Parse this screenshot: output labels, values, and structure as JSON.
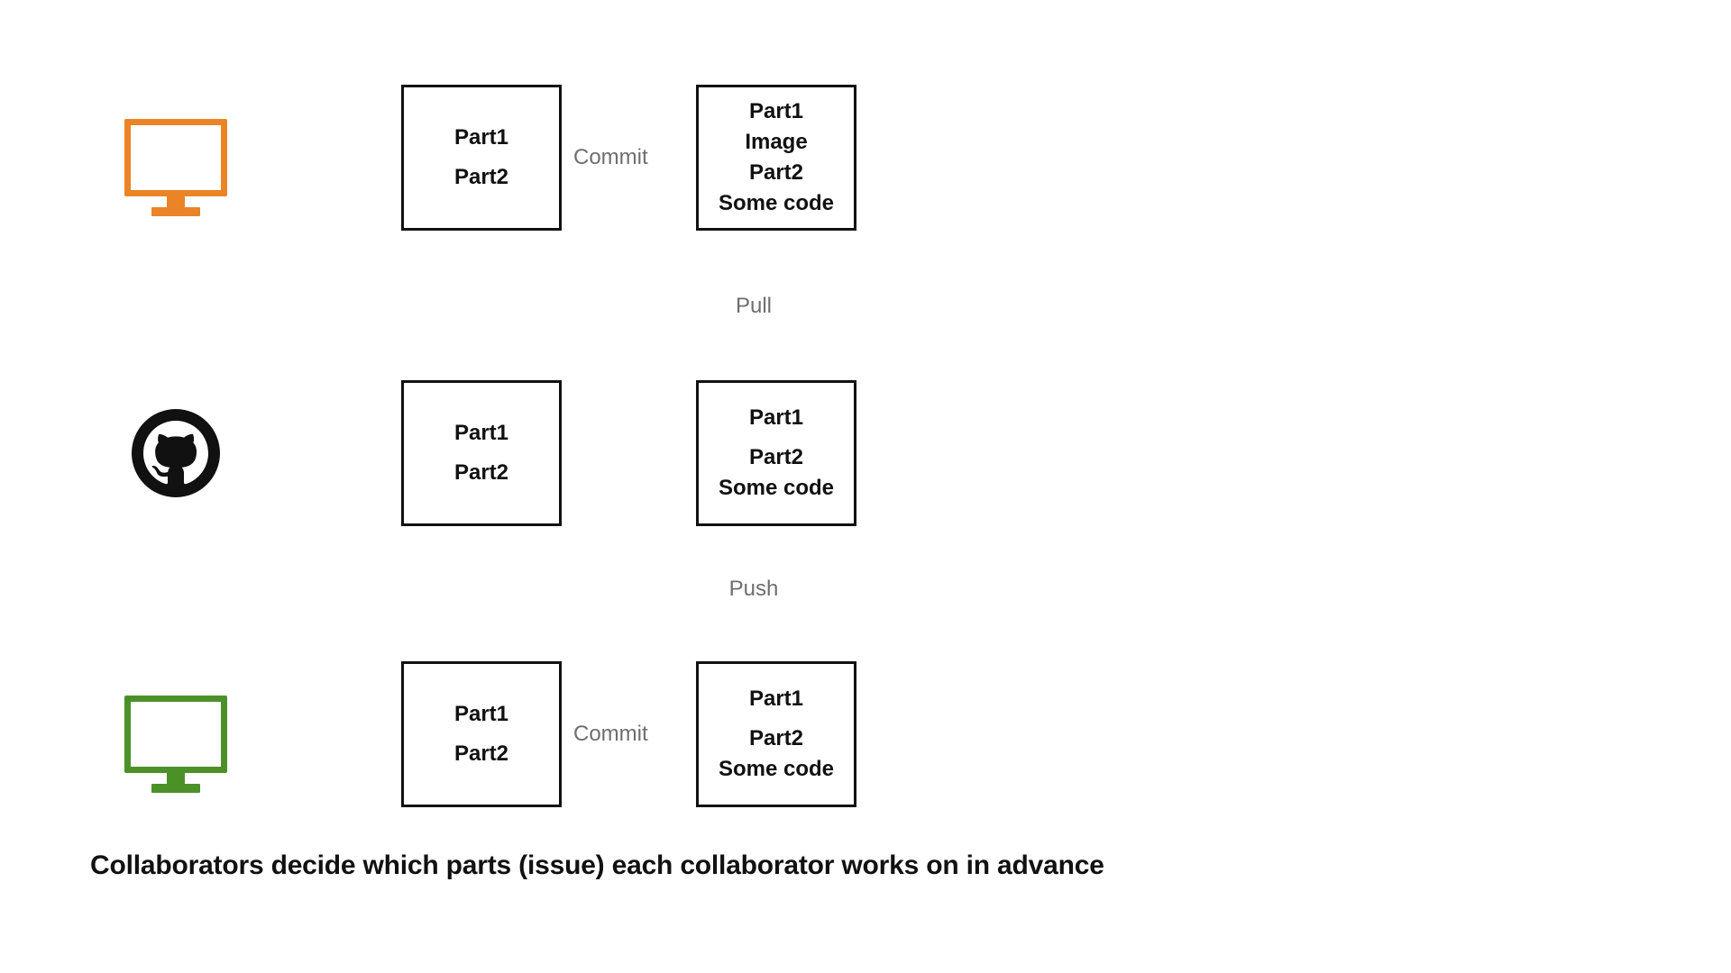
{
  "rows": [
    {
      "icon": "monitor-orange",
      "boxA": [
        "Part1",
        "Part2"
      ],
      "between": "Commit",
      "boxB": [
        "Part1",
        "Image",
        "Part2",
        "Some code"
      ]
    },
    {
      "icon": "github",
      "boxA": [
        "Part1",
        "Part2"
      ],
      "between": "",
      "boxB": [
        "Part1",
        "",
        "Part2",
        "Some code"
      ]
    },
    {
      "icon": "monitor-green",
      "boxA": [
        "Part1",
        "Part2"
      ],
      "between": "Commit",
      "boxB": [
        "Part1",
        "",
        "Part2",
        "Some code"
      ]
    }
  ],
  "stackLabels": [
    "Pull",
    "Push"
  ],
  "caption": "Collaborators decide which parts (issue) each collaborator works on in advance"
}
